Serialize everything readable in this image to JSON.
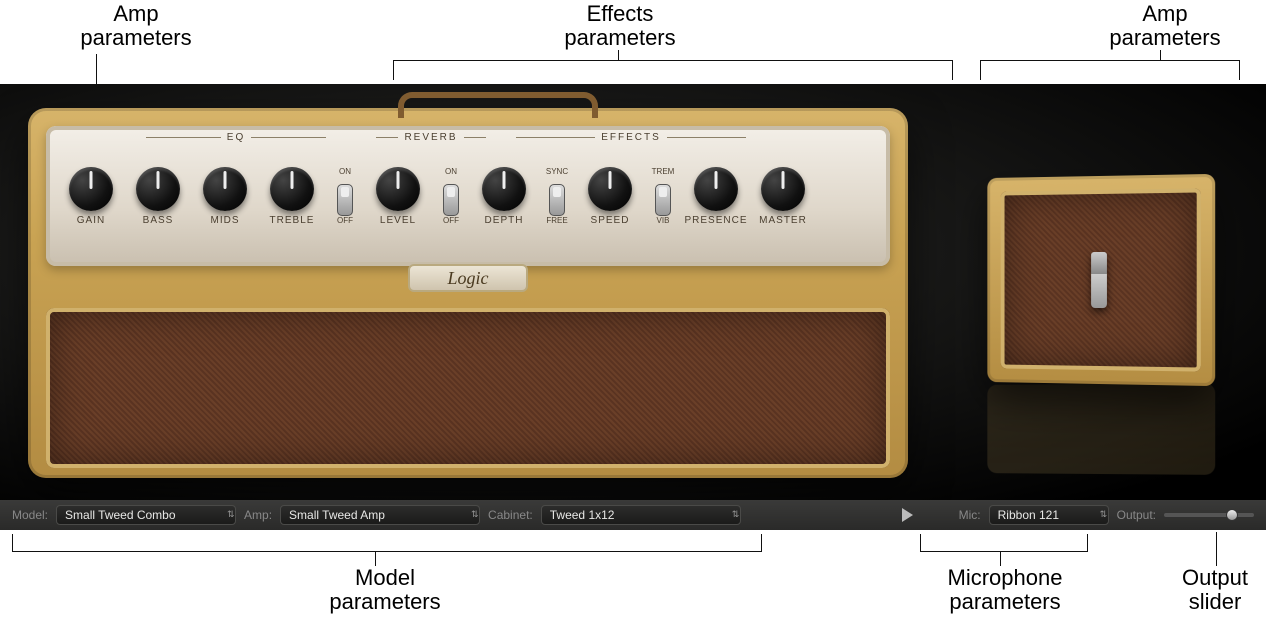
{
  "callouts": {
    "amp_left": "Amp\nparameters",
    "effects": "Effects\nparameters",
    "amp_right": "Amp\nparameters",
    "model": "Model\nparameters",
    "mic": "Microphone\nparameters",
    "output": "Output\nslider"
  },
  "panel": {
    "badge": "Logic",
    "sections": {
      "eq": "EQ",
      "reverb": "REVERB",
      "effects": "EFFECTS"
    },
    "knobs": {
      "gain": "GAIN",
      "bass": "BASS",
      "mids": "MIDS",
      "treble": "TREBLE",
      "level": "LEVEL",
      "depth": "DEPTH",
      "speed": "SPEED",
      "presence": "PRESENCE",
      "master": "MASTER"
    },
    "switches": {
      "reverb": {
        "on": "ON",
        "off": "OFF"
      },
      "effects": {
        "on": "ON",
        "off": "OFF"
      },
      "sync": {
        "on": "SYNC",
        "off": "FREE"
      },
      "trem": {
        "on": "TREM",
        "off": "VIB"
      }
    }
  },
  "bar": {
    "model_label": "Model:",
    "model_value": "Small Tweed Combo",
    "amp_label": "Amp:",
    "amp_value": "Small Tweed Amp",
    "cab_label": "Cabinet:",
    "cab_value": "Tweed 1x12",
    "mic_label": "Mic:",
    "mic_value": "Ribbon 121",
    "output_label": "Output:",
    "output_value_pct": 80
  }
}
